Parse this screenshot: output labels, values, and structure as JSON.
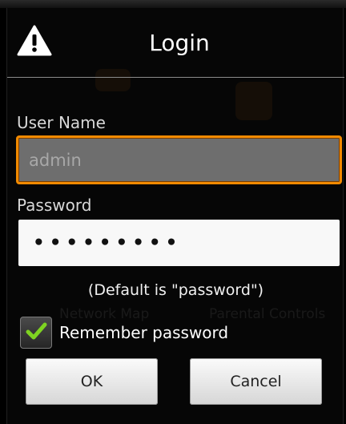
{
  "dialog": {
    "title": "Login",
    "title_icon": "warning-icon"
  },
  "form": {
    "username_label": "User Name",
    "username_value": "admin",
    "password_label": "Password",
    "password_value": "•••••••••",
    "hint": "(Default is \"password\")",
    "remember_label": "Remember password",
    "remember_checked": true
  },
  "buttons": {
    "ok_label": "OK",
    "cancel_label": "Cancel"
  },
  "background": {
    "tile_left_label": "Network Map",
    "tile_right_label": "Parental Controls"
  },
  "colors": {
    "focus_accent": "#f28a00",
    "check_accent": "#7ed321",
    "dialog_background": "#060606"
  }
}
